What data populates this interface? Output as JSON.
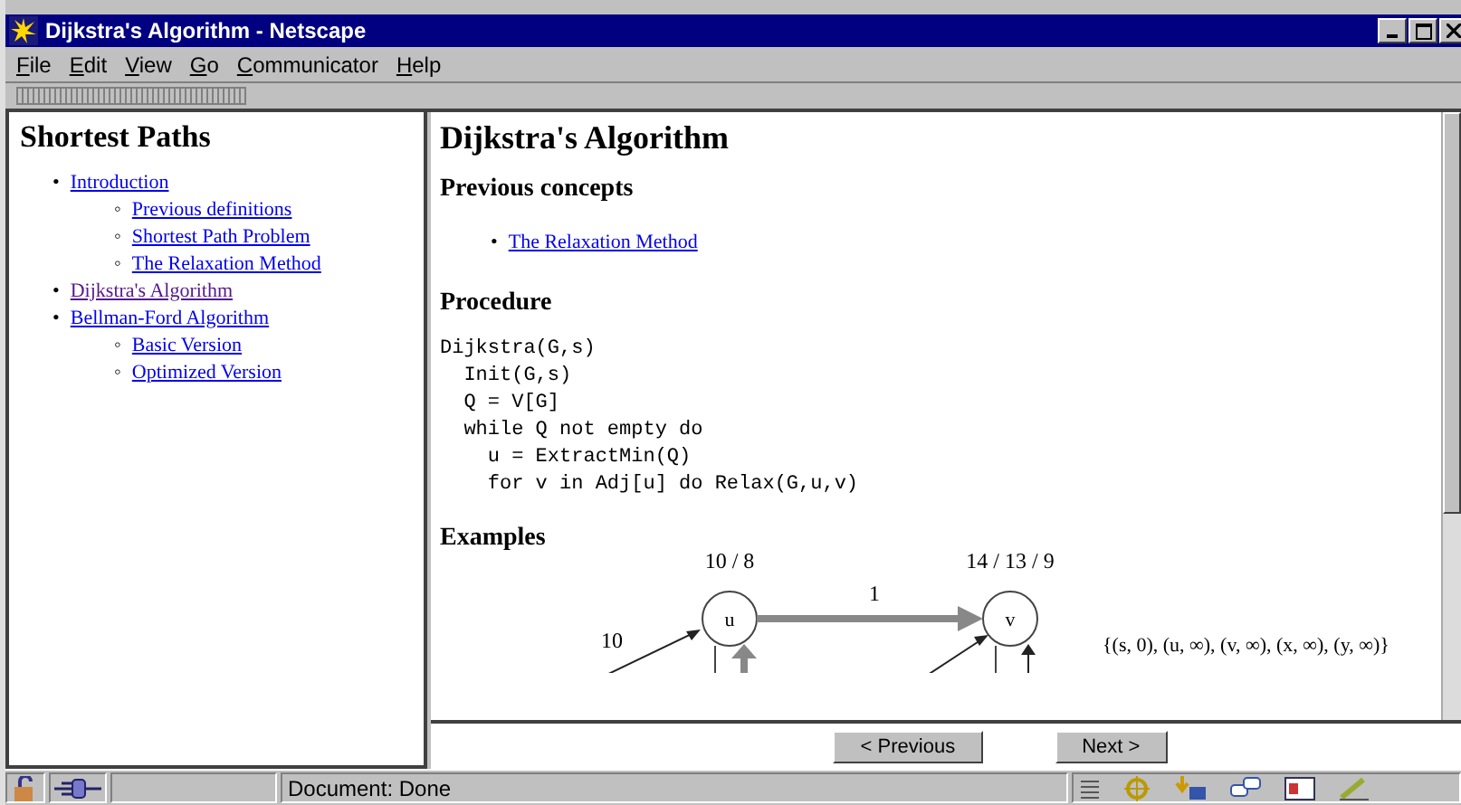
{
  "window": {
    "title": "Dijkstra's Algorithm - Netscape"
  },
  "menu": [
    {
      "label": "File"
    },
    {
      "label": "Edit"
    },
    {
      "label": "View"
    },
    {
      "label": "Go"
    },
    {
      "label": "Communicator"
    },
    {
      "label": "Help"
    }
  ],
  "sidebar": {
    "title": "Shortest Paths",
    "items": [
      {
        "marker": "•",
        "label": "Introduction",
        "visited": false,
        "children": [
          {
            "marker": "◦",
            "label": "Previous definitions",
            "visited": false
          },
          {
            "marker": "◦",
            "label": "Shortest Path Problem",
            "visited": false
          },
          {
            "marker": "◦",
            "label": "The Relaxation Method",
            "visited": false
          }
        ]
      },
      {
        "marker": "•",
        "label": "Dijkstra's Algorithm",
        "visited": true
      },
      {
        "marker": "•",
        "label": "Bellman-Ford Algorithm",
        "visited": false,
        "children": [
          {
            "marker": "◦",
            "label": "Basic Version",
            "visited": false
          },
          {
            "marker": "◦",
            "label": "Optimized Version",
            "visited": false
          }
        ]
      }
    ]
  },
  "main": {
    "title": "Dijkstra's Algorithm",
    "previous_heading": "Previous concepts",
    "previous_links": [
      {
        "marker": "•",
        "label": "The Relaxation Method",
        "visited": false
      }
    ],
    "procedure_heading": "Procedure",
    "code": [
      "Dijkstra(G,s)",
      "  Init(G,s)",
      "  Q = V[G]",
      "  while Q not empty do",
      "    u = ExtractMin(Q)",
      "    for v in Adj[u] do Relax(G,u,v)"
    ],
    "examples_heading": "Examples",
    "diagram": {
      "nodes": [
        {
          "label": "u",
          "distances": "10 / 8"
        },
        {
          "label": "v",
          "distances": "14 / 13 / 9"
        }
      ],
      "edge_weight": "1",
      "incoming_weight": "10",
      "queue": "{(s, 0), (u, ∞), (v, ∞), (x, ∞), (y, ∞)}"
    }
  },
  "nav_buttons": [
    "< Previous",
    "Next >"
  ],
  "status_bar": {
    "text": "Document: Done"
  }
}
